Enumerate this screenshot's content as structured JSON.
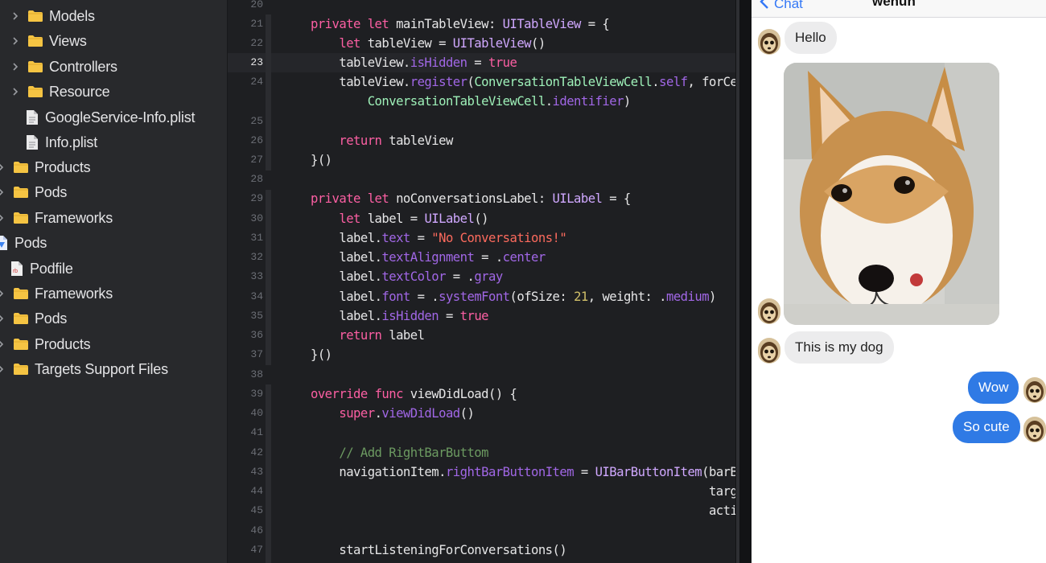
{
  "navigator": {
    "items": [
      {
        "label": "Models",
        "type": "folder",
        "expandable": true
      },
      {
        "label": "Views",
        "type": "folder",
        "expandable": true
      },
      {
        "label": "Controllers",
        "type": "folder",
        "expandable": true
      },
      {
        "label": "Resource",
        "type": "folder",
        "expandable": true
      },
      {
        "label": "GoogleService-Info.plist",
        "type": "file",
        "expandable": false
      },
      {
        "label": "Info.plist",
        "type": "file",
        "expandable": false
      },
      {
        "label": "Products",
        "type": "folder",
        "expandable": true
      },
      {
        "label": "Pods",
        "type": "folder",
        "expandable": true
      },
      {
        "label": "Frameworks",
        "type": "folder",
        "expandable": true
      },
      {
        "label": "Pods",
        "type": "project",
        "expandable": false
      },
      {
        "label": "Podfile",
        "type": "podfile",
        "expandable": false
      },
      {
        "label": "Frameworks",
        "type": "folder",
        "expandable": true
      },
      {
        "label": "Pods",
        "type": "folder",
        "expandable": true
      },
      {
        "label": "Products",
        "type": "folder",
        "expandable": true
      },
      {
        "label": "Targets Support Files",
        "type": "folder",
        "expandable": true
      }
    ]
  },
  "editor": {
    "current_line": "23",
    "lines": [
      {
        "n": "20",
        "code": ""
      },
      {
        "n": "21",
        "code": "private let mainTableView: UITableView = {"
      },
      {
        "n": "22",
        "code": "    let tableView = UITableView()"
      },
      {
        "n": "23",
        "code": "    tableView.isHidden = true"
      },
      {
        "n": "24",
        "code": "    tableView.register(ConversationTableViewCell.self, forCel"
      },
      {
        "n": "",
        "code": "        ConversationTableViewCell.identifier)"
      },
      {
        "n": "25",
        "code": ""
      },
      {
        "n": "26",
        "code": "    return tableView"
      },
      {
        "n": "27",
        "code": "}()"
      },
      {
        "n": "28",
        "code": ""
      },
      {
        "n": "29",
        "code": "private let noConversationsLabel: UILabel = {"
      },
      {
        "n": "30",
        "code": "    let label = UILabel()"
      },
      {
        "n": "31",
        "code": "    label.text = \"No Conversations!\""
      },
      {
        "n": "32",
        "code": "    label.textAlignment = .center"
      },
      {
        "n": "33",
        "code": "    label.textColor = .gray"
      },
      {
        "n": "34",
        "code": "    label.font = .systemFont(ofSize: 21, weight: .medium)"
      },
      {
        "n": "35",
        "code": "    label.isHidden = true"
      },
      {
        "n": "36",
        "code": "    return label"
      },
      {
        "n": "37",
        "code": "}()"
      },
      {
        "n": "38",
        "code": ""
      },
      {
        "n": "39",
        "code": "override func viewDidLoad() {"
      },
      {
        "n": "40",
        "code": "    super.viewDidLoad()"
      },
      {
        "n": "41",
        "code": ""
      },
      {
        "n": "42",
        "code": "    // Add RightBarButtom"
      },
      {
        "n": "43",
        "code": "    navigationItem.rightBarButtonItem = UIBarButtonItem(barBu"
      },
      {
        "n": "44",
        "code": "                                                        targe"
      },
      {
        "n": "45",
        "code": "                                                        actio"
      },
      {
        "n": "46",
        "code": ""
      },
      {
        "n": "47",
        "code": "    startListeningForConversations()"
      }
    ]
  },
  "chat": {
    "back_label": "Chat",
    "title": "wenun",
    "messages": [
      {
        "sender": "other",
        "kind": "text",
        "text": "Hello"
      },
      {
        "sender": "other",
        "kind": "photo",
        "text": ""
      },
      {
        "sender": "other",
        "kind": "text",
        "text": "This is my dog"
      },
      {
        "sender": "me",
        "kind": "text",
        "text": "Wow"
      },
      {
        "sender": "me",
        "kind": "text",
        "text": "So cute"
      }
    ]
  },
  "colors": {
    "keyword": "#fc5fa3",
    "type": "#d0a8ff",
    "string": "#fc6a5d",
    "number": "#d0bf69",
    "comment": "#6c9a61",
    "outgoing_bubble": "#2f7ae5",
    "incoming_bubble": "#ececed",
    "link_blue": "#3478f6"
  }
}
